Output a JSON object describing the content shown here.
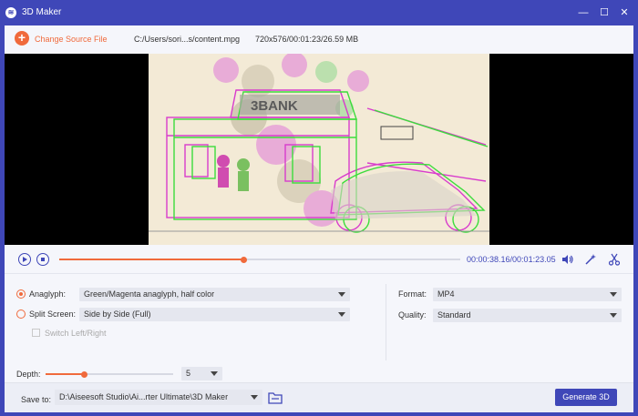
{
  "window": {
    "title": "3D Maker",
    "minimize": "—",
    "maximize": "☐",
    "close": "✕"
  },
  "source": {
    "change_label": "Change Source File",
    "path": "C:/Users/sori...s/content.mpg",
    "info": "720x576/00:01:23/26.59 MB"
  },
  "player": {
    "current_time": "00:00:38.16",
    "total_time": "/00:01:23.05",
    "progress": 0.46
  },
  "settings": {
    "anaglyph_label": "Anaglyph:",
    "anaglyph_value": "Green/Magenta anaglyph, half color",
    "split_label": "Split Screen:",
    "split_value": "Side by Side (Full)",
    "switch_label": "Switch Left/Right",
    "depth_label": "Depth:",
    "depth_value": "5",
    "depth_level": 0.3,
    "format_label": "Format:",
    "format_value": "MP4",
    "quality_label": "Quality:",
    "quality_value": "Standard"
  },
  "save": {
    "label": "Save to:",
    "path": "D:\\Aiseesoft Studio\\Ai...rter Ultimate\\3D Maker",
    "generate_label": "Generate 3D"
  },
  "colors": {
    "accent": "#3f47b8",
    "orange": "#f06a3c",
    "green": "#3cdc3c",
    "magenta": "#e040d0"
  }
}
